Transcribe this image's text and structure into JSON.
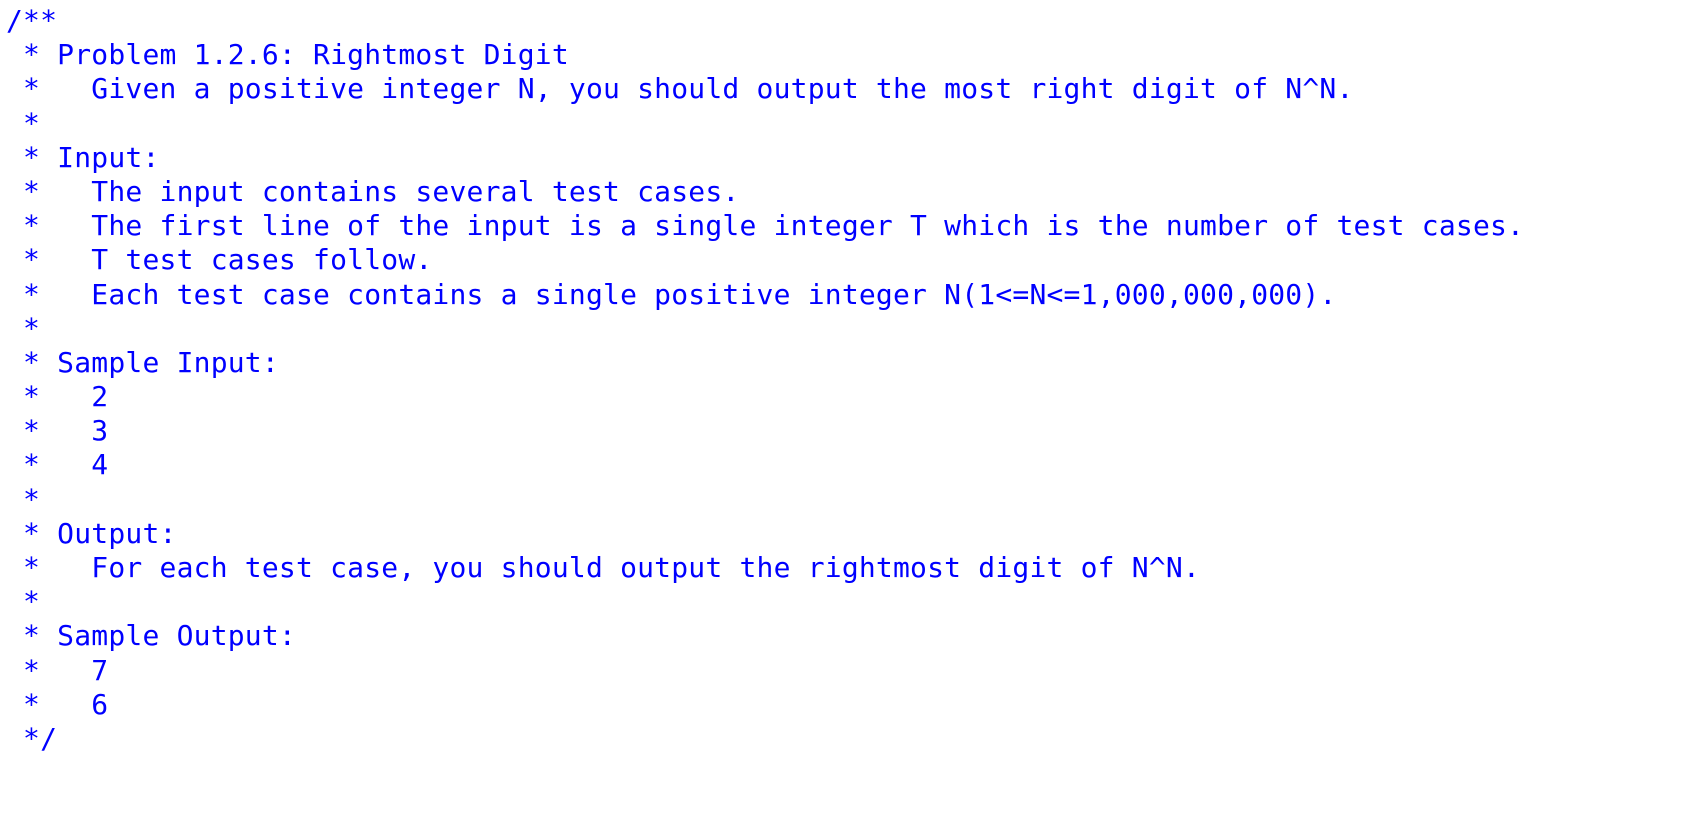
{
  "editor": {
    "text_color": "#0000ff",
    "background": "#ffffff",
    "lines": [
      "/**",
      " * Problem 1.2.6: Rightmost Digit",
      " *   Given a positive integer N, you should output the most right digit of N^N.",
      " *",
      " * Input:",
      " *   The input contains several test cases.",
      " *   The first line of the input is a single integer T which is the number of test cases.",
      " *   T test cases follow.",
      " *   Each test case contains a single positive integer N(1<=N<=1,000,000,000).",
      " *",
      " * Sample Input:",
      " *   2",
      " *   3",
      " *   4",
      " *",
      " * Output:",
      " *   For each test case, you should output the rightmost digit of N^N.",
      " *",
      " * Sample Output:",
      " *   7",
      " *   6",
      " */"
    ]
  }
}
